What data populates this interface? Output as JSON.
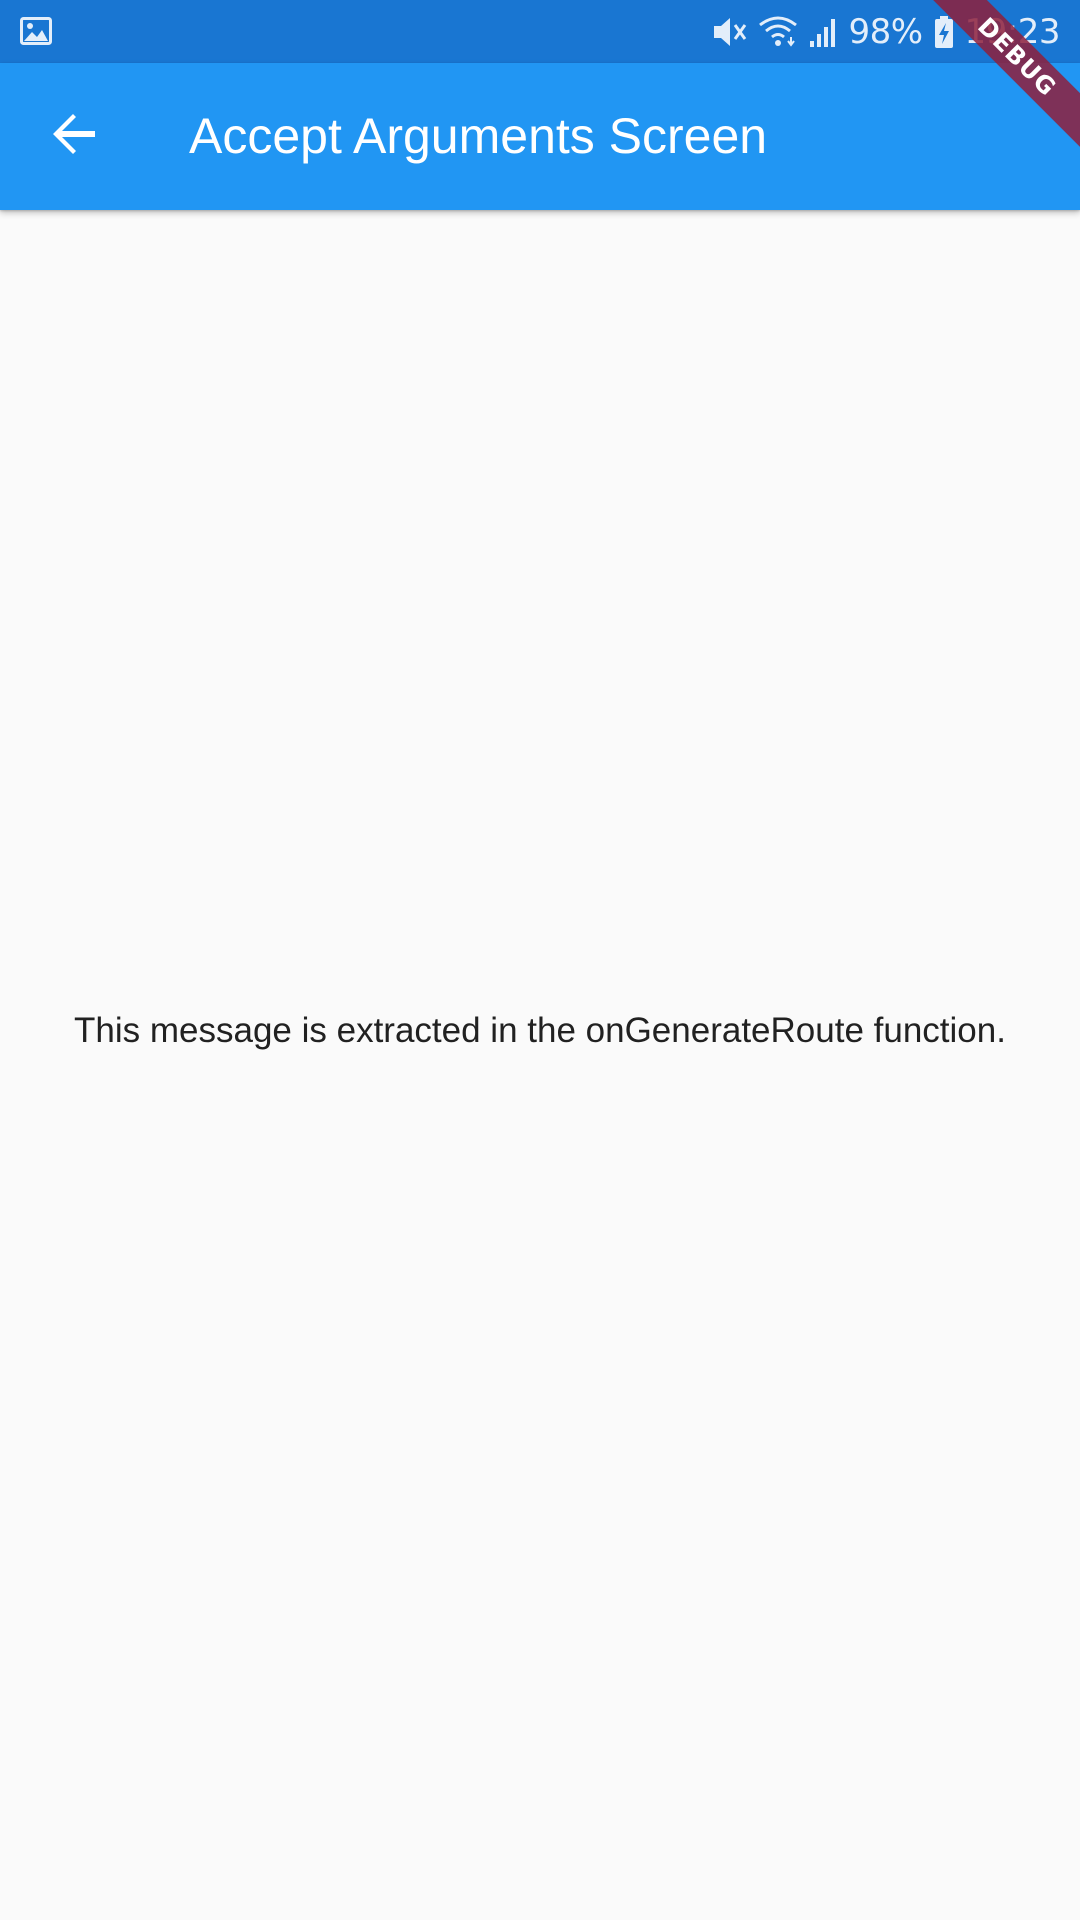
{
  "status_bar": {
    "left_icon": "image-icon",
    "mute_icon": "vibrate-mute-icon",
    "wifi_icon": "wifi-icon",
    "signal_icon": "cell-signal-icon",
    "battery_percent": "98%",
    "battery_icon": "battery-charging-icon",
    "time": "19:23"
  },
  "app_bar": {
    "back_icon": "arrow-back-icon",
    "title": "Accept Arguments Screen",
    "color": "#2196f3"
  },
  "body": {
    "message": "This message is extracted in the onGenerateRoute function."
  },
  "debug_banner": {
    "label": "DEBUG"
  },
  "colors": {
    "status_bar": "#1976d2",
    "app_bar": "#2196f3",
    "background": "#fafafa",
    "debug_banner": "#8e203c"
  }
}
